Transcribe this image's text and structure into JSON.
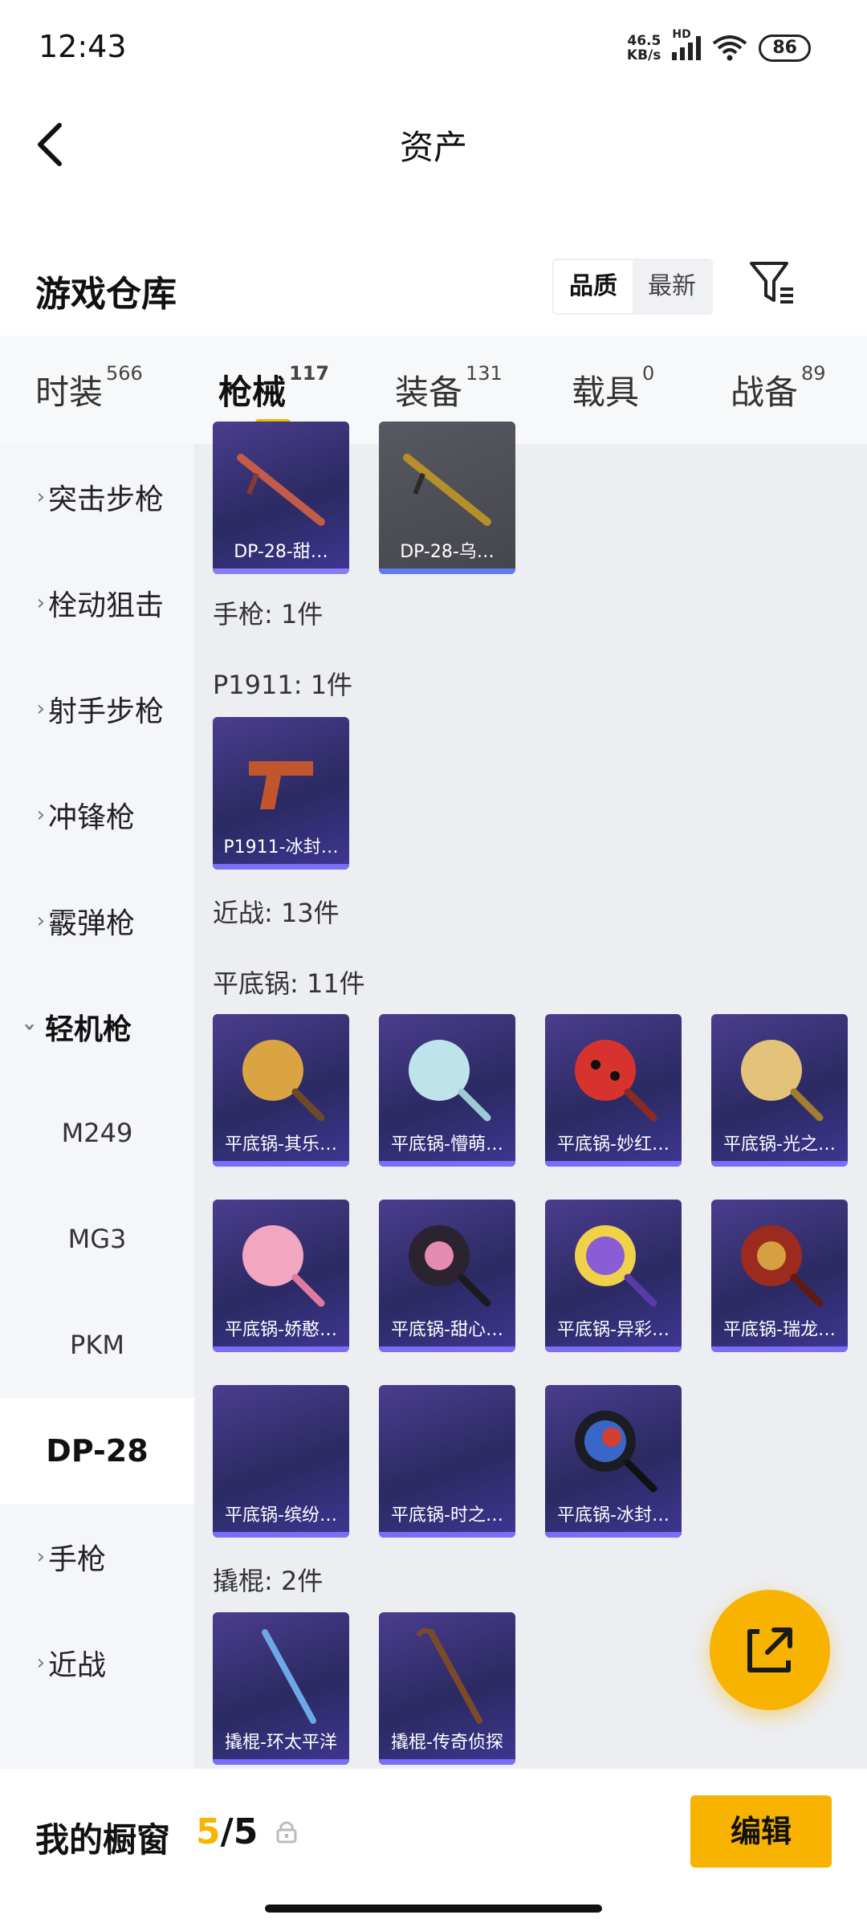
{
  "status": {
    "time": "12:43",
    "net_speed": "46.5",
    "net_unit": "KB/s",
    "battery": "86",
    "wifi_sub": "7",
    "hd": "HD"
  },
  "header": {
    "title": "资产"
  },
  "warehouse": {
    "title": "游戏仓库",
    "sort_quality": "品质",
    "sort_newest": "最新"
  },
  "tabs": [
    {
      "label": "时装",
      "count": "566"
    },
    {
      "label": "枪械",
      "count": "117"
    },
    {
      "label": "装备",
      "count": "131"
    },
    {
      "label": "载具",
      "count": "0"
    },
    {
      "label": "战备",
      "count": "89"
    }
  ],
  "sidebar": {
    "items": [
      "突击步枪",
      "栓动狙击",
      "射手步枪",
      "冲锋枪",
      "霰弹枪",
      "轻机枪"
    ],
    "sub_items": [
      "M249",
      "MG3",
      "PKM",
      "DP-28"
    ],
    "tail_items": [
      "手枪",
      "近战"
    ]
  },
  "sections": {
    "pistol": "手枪: 1件",
    "p1911": "P1911: 1件",
    "melee": "近战: 13件",
    "pan": "平底锅: 11件",
    "crowbar": "撬棍: 2件"
  },
  "cards": {
    "dp28": [
      "DP-28-甜…",
      "DP-28-乌…"
    ],
    "p1911": [
      "P1911-冰封…"
    ],
    "pans": [
      "平底锅-其乐…",
      "平底锅-懵萌…",
      "平底锅-妙红…",
      "平底锅-光之…",
      "平底锅-娇憨…",
      "平底锅-甜心…",
      "平底锅-异彩…",
      "平底锅-瑞龙…",
      "平底锅-缤纷…",
      "平底锅-时之…",
      "平底锅-冰封…"
    ],
    "crowbars": [
      "撬棍-环太平洋",
      "撬棍-传奇侦探"
    ]
  },
  "bottom": {
    "title": "我的橱窗",
    "current": "5",
    "total": "/5",
    "edit": "编辑"
  },
  "colors": {
    "accent": "#f8b200",
    "card": "#3a3280"
  }
}
